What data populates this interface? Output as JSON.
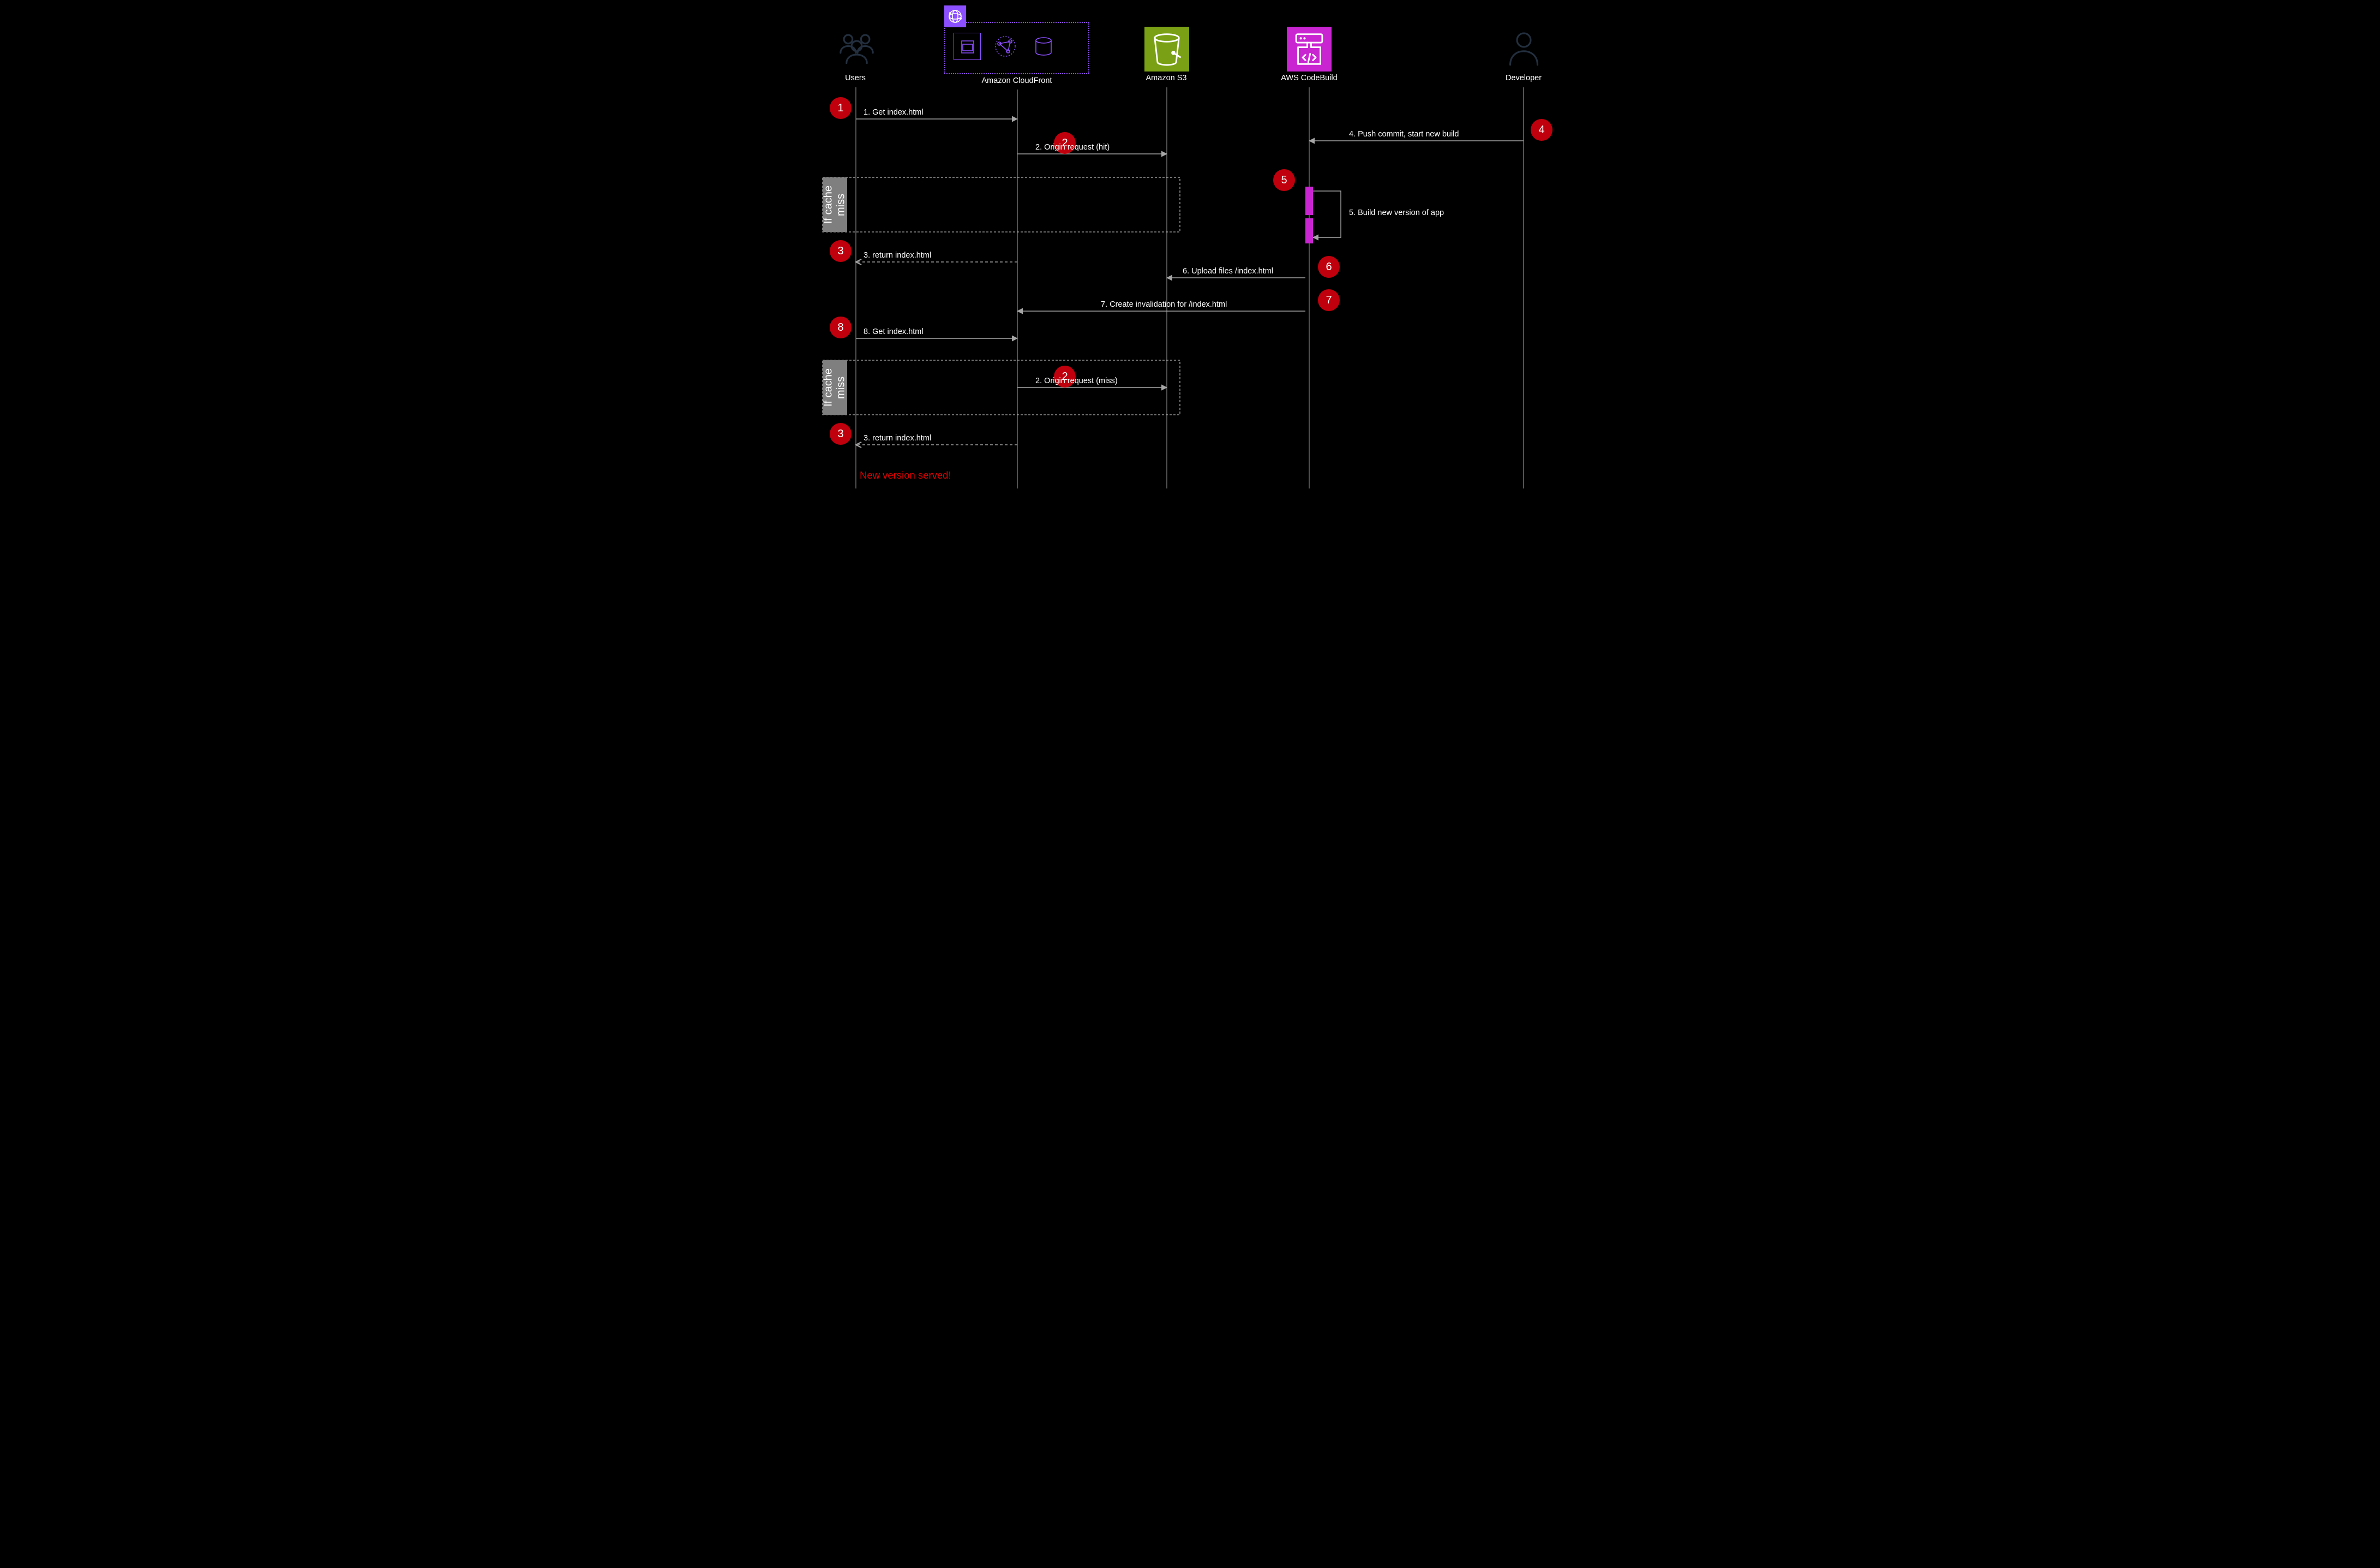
{
  "lanes": {
    "users": "Users",
    "cloudfront": "Amazon CloudFront",
    "s3": "Amazon S3",
    "codebuild": "AWS CodeBuild",
    "developer": "Developer"
  },
  "steps": {
    "s1": {
      "num": "1",
      "text": "1. Get index.html"
    },
    "s2": {
      "num": "2",
      "text": "2. Origin request (hit)"
    },
    "s3": {
      "num": "3",
      "text": "3. return index.html"
    },
    "s4": {
      "num": "4",
      "text": "4. Push commit, start new build"
    },
    "s5": {
      "num": "5",
      "text": "5. Build new version of app"
    },
    "s6": {
      "num": "6",
      "text": "6. Upload files /index.html"
    },
    "s7": {
      "num": "7",
      "text": "7. Create invalidation for /index.html"
    },
    "s8": {
      "num": "8",
      "text": "8. Get index.html"
    },
    "s2b": {
      "num": "2",
      "text": "2. Origin request (miss)"
    },
    "s3b": {
      "num": "3",
      "text": "3. return index.html"
    }
  },
  "box": {
    "cachemiss": "If cache miss"
  },
  "footer": {
    "newversion": "New version served!"
  },
  "chart_data": {
    "type": "sequence-diagram",
    "participants": [
      "Users",
      "Amazon CloudFront",
      "Amazon S3",
      "AWS CodeBuild",
      "Developer"
    ],
    "fragments": [
      {
        "type": "opt",
        "label": "If cache miss",
        "covers": [
          "Users",
          "Amazon CloudFront",
          "Amazon S3"
        ]
      }
    ],
    "messages": [
      {
        "n": 1,
        "from": "Users",
        "to": "Amazon CloudFront",
        "text": "Get index.html"
      },
      {
        "n": 2,
        "from": "Amazon CloudFront",
        "to": "Amazon S3",
        "text": "Origin request (hit)",
        "fragment": "If cache miss"
      },
      {
        "n": 3,
        "from": "Amazon CloudFront",
        "to": "Users",
        "text": "return index.html",
        "style": "dashed-return"
      },
      {
        "n": 4,
        "from": "Developer",
        "to": "AWS CodeBuild",
        "text": "Push commit, start new build"
      },
      {
        "n": 5,
        "from": "AWS CodeBuild",
        "to": "AWS CodeBuild",
        "text": "Build new version of app",
        "self": true
      },
      {
        "n": 6,
        "from": "AWS CodeBuild",
        "to": "Amazon S3",
        "text": "Upload files /index.html"
      },
      {
        "n": 7,
        "from": "AWS CodeBuild",
        "to": "Amazon CloudFront",
        "text": "Create invalidation for /index.html"
      },
      {
        "n": 8,
        "from": "Users",
        "to": "Amazon CloudFront",
        "text": "Get index.html"
      },
      {
        "n": 2,
        "from": "Amazon CloudFront",
        "to": "Amazon S3",
        "text": "Origin request (miss)",
        "fragment": "If cache miss"
      },
      {
        "n": 3,
        "from": "Amazon CloudFront",
        "to": "Users",
        "text": "return index.html",
        "style": "dashed-return"
      }
    ],
    "note": {
      "at": "Users",
      "text": "New version served!",
      "color": "red"
    }
  }
}
